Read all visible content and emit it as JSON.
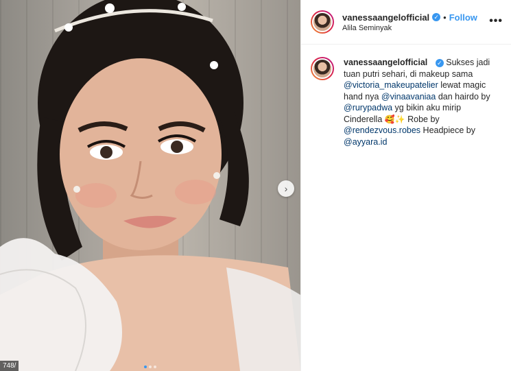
{
  "post": {
    "username": "vanessaangelofficial",
    "follow_label": "Follow",
    "separator": "•",
    "location": "Alila Seminyak",
    "more_icon": "•••",
    "verified_icon": "✓",
    "next_icon": "›",
    "image_counter": "748/"
  },
  "caption": {
    "segments": [
      {
        "type": "text",
        "value": "Sukses jadi tuan putri sehari, di makeup sama "
      },
      {
        "type": "mention",
        "value": "@victoria_makeupatelier"
      },
      {
        "type": "text",
        "value": " lewat magic hand nya "
      },
      {
        "type": "mention",
        "value": "@vinaavaniaa"
      },
      {
        "type": "text",
        "value": " dan hairdo by "
      },
      {
        "type": "mention",
        "value": "@rurypadwa"
      },
      {
        "type": "text",
        "value": " yg bikin aku mirip Cinderella "
      },
      {
        "type": "emoji",
        "value": "🥰✨"
      },
      {
        "type": "text",
        "value": " Robe by "
      },
      {
        "type": "mention",
        "value": "@rendezvous.robes"
      },
      {
        "type": "text",
        "value": " Headpiece by "
      },
      {
        "type": "mention",
        "value": "@ayyara.id"
      }
    ]
  },
  "carousel": {
    "count": 3,
    "active": 0
  },
  "colors": {
    "accent": "#3897f0",
    "mention": "#00376b",
    "text": "#262626"
  }
}
